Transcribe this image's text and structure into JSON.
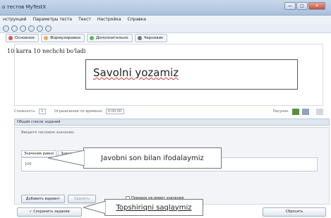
{
  "window": {
    "title": "o тестов MyTestX",
    "buttons": {
      "minimize": "—",
      "maximize": "□",
      "close": "✕"
    }
  },
  "menu": [
    "нструкций",
    "Параметры теста",
    "Текст",
    "Настройка",
    "Справка"
  ],
  "tabs": [
    {
      "label": "Основное",
      "color": "#d9534f"
    },
    {
      "label": "Формулировки",
      "color": "#f0ad4e"
    },
    {
      "label": "Дополнительно",
      "color": "#5cb85c"
    },
    {
      "label": "Черновик",
      "color": "#777777"
    }
  ],
  "editor": {
    "question_text": "10 karra 10 nechchi bo'ladi"
  },
  "callouts": {
    "main": "Savolni yozamiz",
    "answer": "Javobni son bilan ifodalaymiz",
    "save": "Topshiriqni saqlaymiz"
  },
  "status": {
    "complexity_label": "Сложность:",
    "complexity_value": "1",
    "time_label": "Ограничение по времени:",
    "time_value": "0:00:00",
    "picture_label": "Рисунок:"
  },
  "answers_panel": {
    "header": "Общий список заданий",
    "hint": "Введите числовое значение:",
    "tab_exact": "Значение равно",
    "tab_range": "Значение",
    "value": "100",
    "add_variant": "Добавить вариант",
    "delete_variant": "Удалить",
    "shuffle_label": "Порядок не имеет значения"
  },
  "footer": {
    "save_button": "Сохранить задание",
    "reset_button": "Сбросить"
  }
}
